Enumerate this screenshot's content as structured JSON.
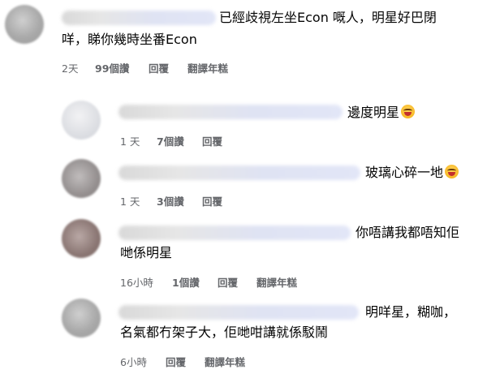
{
  "comments": [
    {
      "line1": "已經歧視左坐Econ 嘅人，明星好巴閉",
      "line2": "咩，睇你幾時坐番Econ",
      "time": "2天",
      "likes": "99個讚",
      "reply": "回覆",
      "translate": "翻譯年糕"
    },
    {
      "line1": "邊度明星",
      "emoji": "laughing-crying-emoji",
      "time": "1 天",
      "likes": "7個讚",
      "reply": "回覆"
    },
    {
      "line1": "玻璃心碎一地",
      "emoji": "laughing-crying-emoji",
      "time": "1 天",
      "likes": "3個讚",
      "reply": "回覆"
    },
    {
      "line1": "你唔講我都唔知佢",
      "line2": "哋係明星",
      "time": "16小時",
      "likes": "1個讚",
      "reply": "回覆",
      "translate": "翻譯年糕"
    },
    {
      "line1": "明咩星，糊咖，",
      "line2": "名氣都冇架子大，佢哋咁講就係駁鬧",
      "time": "6小時",
      "reply": "回覆",
      "translate": "翻譯年糕"
    }
  ]
}
